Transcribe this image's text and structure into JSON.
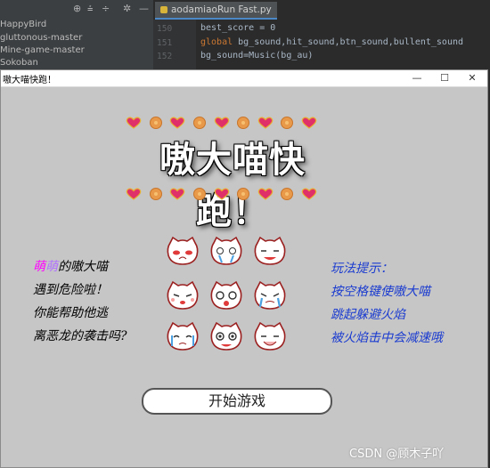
{
  "ide": {
    "toolbar_icons": [
      "target-icon",
      "collapse-icon",
      "expand-icon",
      "gear-icon",
      "minimize-icon"
    ],
    "project_items": [
      "HappyBird",
      "gluttonous-master",
      "Mine-game-master",
      "Sokoban"
    ],
    "tab_label": "aodamiaoRun Fast.py",
    "line_numbers": [
      "150",
      "151",
      "152"
    ],
    "code": {
      "line1": "best_score = 0",
      "line2_kw": "global",
      "line2_rest": " bg_sound,hit_sound,btn_sound,bullent_sound",
      "line3": "bg_sound=Music(bg_au)"
    }
  },
  "window": {
    "title": "嗷大喵快跑！",
    "minimize": "—",
    "maximize": "☐",
    "close": "✕"
  },
  "game": {
    "title": "嗷大喵快跑！",
    "story": {
      "line1_a": "萌",
      "line1_b": "萌",
      "line1_c": "的嗷大喵",
      "line2": "遇到危险啦！",
      "line3": "你能帮助他逃",
      "line4": "离恶龙的袭击吗?"
    },
    "tips": {
      "line1": "玩法提示：",
      "line2": "按空格键使嗷大喵",
      "line3": "跳起躲避火焰",
      "line4": "被火焰击中会减速哦"
    },
    "start_button": "开始游戏",
    "colors": {
      "background": "#c6c6c6",
      "tip_text": "#1a3bd0",
      "heart": "#e0306a",
      "flower": "#e89a4a"
    }
  },
  "watermark": "CSDN @顾木子吖"
}
